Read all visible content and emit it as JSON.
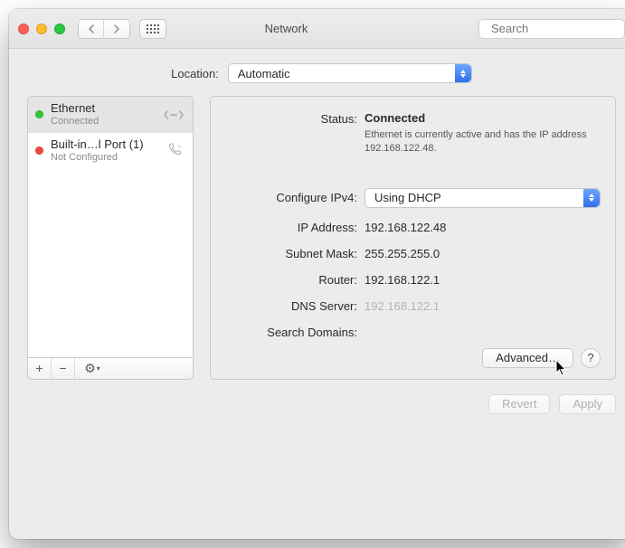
{
  "window": {
    "title": "Network"
  },
  "search": {
    "placeholder": "Search"
  },
  "location": {
    "label": "Location:",
    "value": "Automatic"
  },
  "sidebar": {
    "items": [
      {
        "name": "Ethernet",
        "sub": "Connected",
        "status": "green",
        "icon": "ethernet",
        "selected": true
      },
      {
        "name": "Built-in…l Port (1)",
        "sub": "Not Configured",
        "status": "red",
        "icon": "phone",
        "selected": false
      }
    ],
    "tools": {
      "add": "+",
      "remove": "−",
      "gear": "⚙︎",
      "gear_arrow": "▾"
    }
  },
  "detail": {
    "status_label": "Status:",
    "status_value": "Connected",
    "status_sub": "Ethernet is currently active and has the IP address 192.168.122.48.",
    "ipv4_label": "Configure IPv4:",
    "ipv4_value": "Using DHCP",
    "ip_label": "IP Address:",
    "ip_value": "192.168.122.48",
    "mask_label": "Subnet Mask:",
    "mask_value": "255.255.255.0",
    "router_label": "Router:",
    "router_value": "192.168.122.1",
    "dns_label": "DNS Server:",
    "dns_value": "192.168.122.1",
    "search_label": "Search Domains:",
    "search_value": "",
    "advanced_label": "Advanced…",
    "help_label": "?"
  },
  "footer": {
    "revert": "Revert",
    "apply": "Apply"
  }
}
